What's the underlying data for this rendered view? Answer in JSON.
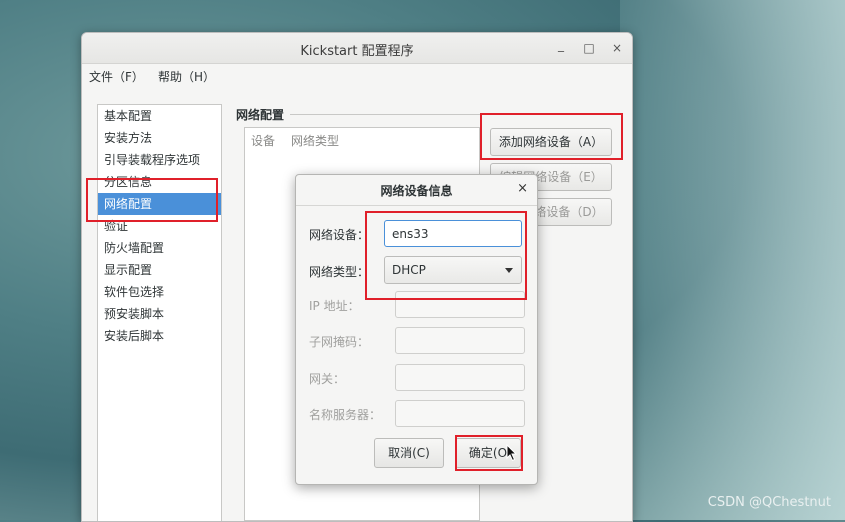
{
  "desktop": {
    "watermark": "CSDN @QChestnut"
  },
  "window": {
    "title": "Kickstart 配置程序",
    "controls": {
      "minimize": "_",
      "maximize": "□",
      "close": "×"
    }
  },
  "menubar": {
    "file": "文件（F）",
    "help": "帮助（H）"
  },
  "sidebar": {
    "items": [
      {
        "label": "基本配置"
      },
      {
        "label": "安装方法"
      },
      {
        "label": "引导装载程序选项"
      },
      {
        "label": "分区信息"
      },
      {
        "label": "网络配置"
      },
      {
        "label": "验证"
      },
      {
        "label": "防火墙配置"
      },
      {
        "label": "显示配置"
      },
      {
        "label": "软件包选择"
      },
      {
        "label": "预安装脚本"
      },
      {
        "label": "安装后脚本"
      }
    ],
    "selected": "网络配置"
  },
  "network": {
    "section_title": "网络配置",
    "columns": [
      "设备",
      "网络类型"
    ],
    "buttons": {
      "add": "添加网络设备（A）",
      "edit": "编辑网络设备（E）",
      "delete": "删除网络设备（D）"
    }
  },
  "dialog": {
    "title": "网络设备信息",
    "close": "×",
    "fields": {
      "device_label": "网络设备：",
      "device_value": "ens33",
      "type_label": "网络类型：",
      "type_value": "DHCP",
      "ip_label": "IP 地址：",
      "netmask_label": "子网掩码：",
      "gateway_label": "网关：",
      "nameserver_label": "名称服务器："
    },
    "buttons": {
      "cancel": "取消(C)",
      "ok": "确定(O"
    }
  }
}
